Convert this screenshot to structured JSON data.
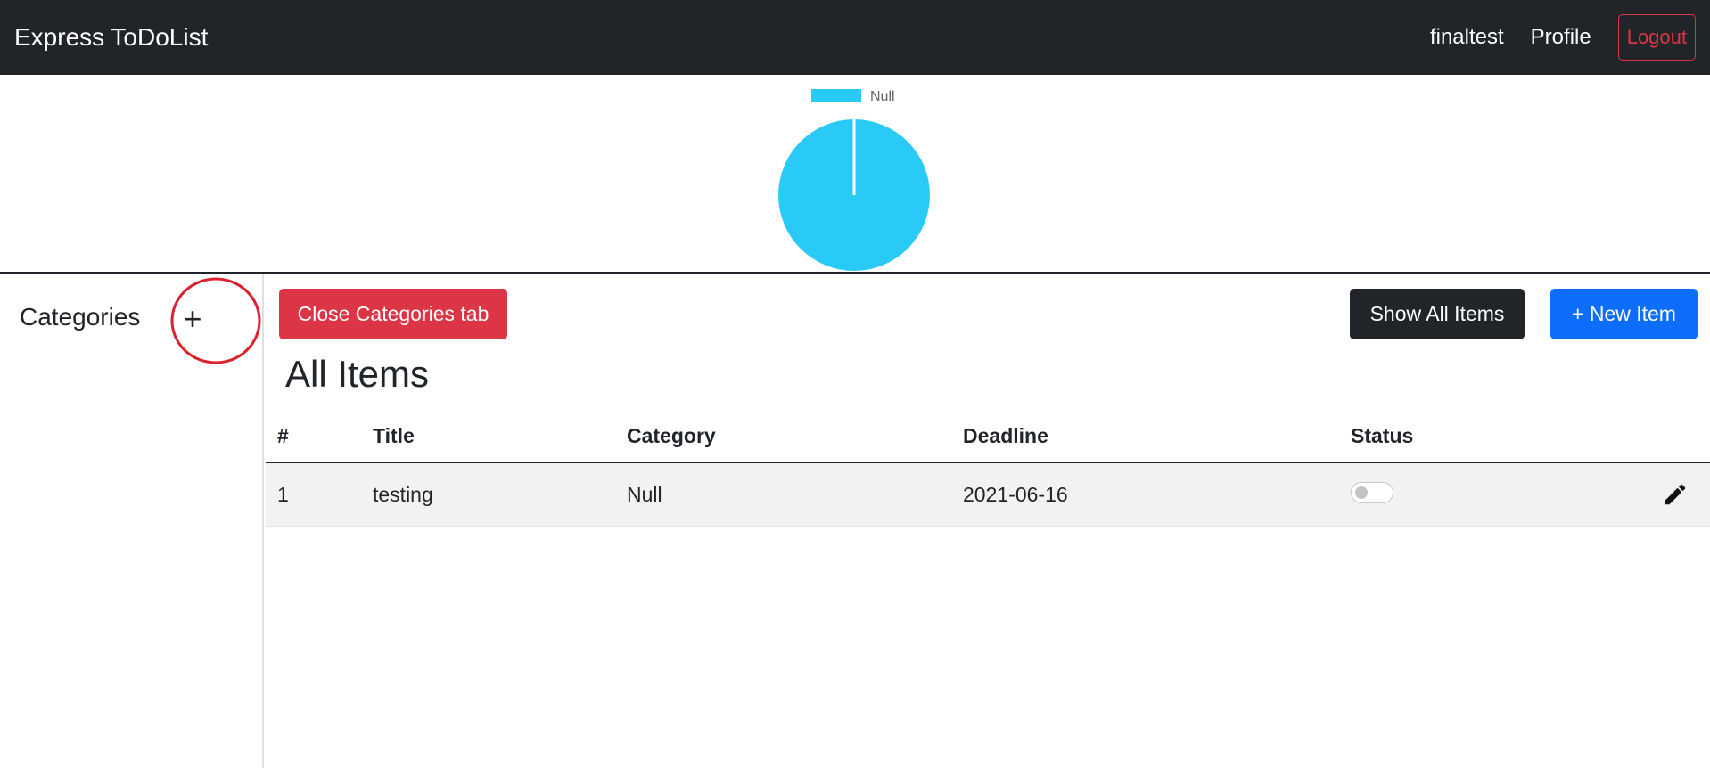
{
  "navbar": {
    "brand": "Express ToDoList",
    "username": "finaltest",
    "profile_label": "Profile",
    "logout_label": "Logout"
  },
  "chart_data": {
    "type": "pie",
    "labels": [
      "Null"
    ],
    "values": [
      1
    ],
    "colors": [
      "#29cbf6"
    ],
    "legend": "top"
  },
  "sidebar": {
    "title": "Categories",
    "add_label": "+"
  },
  "toolbar": {
    "close_categories_label": "Close Categories tab",
    "show_all_label": "Show All Items",
    "new_item_label": "+ New Item"
  },
  "main": {
    "title": "All Items",
    "table": {
      "headers": [
        "#",
        "Title",
        "Category",
        "Deadline",
        "Status"
      ],
      "rows": [
        {
          "num": "1",
          "title": "testing",
          "category": "Null",
          "deadline": "2021-06-16",
          "status_on": false
        }
      ]
    }
  },
  "icons": {
    "add": "plus-icon",
    "edit": "pencil-icon"
  },
  "colors": {
    "navbar": "#212529",
    "danger": "#dc3545",
    "primary": "#0d6efd",
    "dark": "#212529",
    "annotation": "#d9232e"
  }
}
